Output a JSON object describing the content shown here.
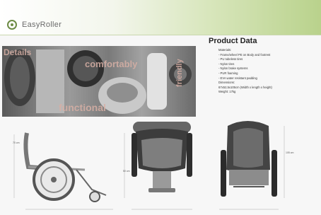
{
  "header": {
    "brand": "EasyRoller",
    "brand_color": "#6d8b45",
    "logo_icon": "circle-logo-icon"
  },
  "product_data": {
    "title": "Product Data",
    "lines": [
      "Materials:",
      "- Frame/wheel PE on Body and footrest",
      "- PU tubeless tires",
      "- Nylon tires",
      "- Nylon brake systems",
      "- PUR foaming",
      "- EVA water resistant padding",
      "Dimensions:",
      "67x52,5x105cm (Width x length x height)",
      "Weight: 17kg"
    ]
  },
  "banner": {
    "words": [
      "Details",
      "comfortably",
      "functional",
      "friendly"
    ]
  },
  "dimensions": {
    "side_height": "70 cm",
    "front_height": "50 cm",
    "back_height": "105 cm"
  }
}
